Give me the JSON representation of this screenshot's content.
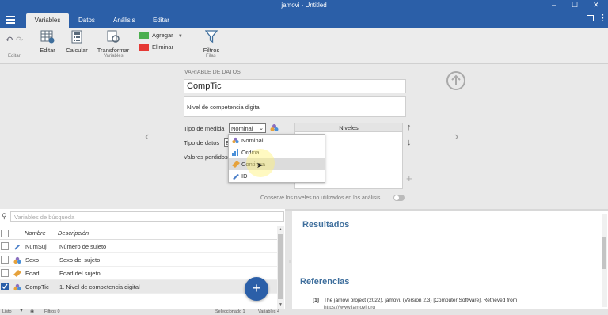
{
  "window": {
    "title": "jamovi - Untitled"
  },
  "tabs": [
    {
      "label": "Variables",
      "active": true
    },
    {
      "label": "Datos",
      "active": false
    },
    {
      "label": "Análisis",
      "active": false
    },
    {
      "label": "Editar",
      "active": false
    }
  ],
  "ribbon": {
    "editar_group": "Editar",
    "variables_group": "Variables",
    "filas_group": "Filas",
    "editar": "Editar",
    "calcular": "Calcular",
    "transformar": "Transformar",
    "agregar": "Agregar",
    "eliminar": "Eliminar",
    "filtros": "Filtros"
  },
  "editor": {
    "header": "VARIABLE DE DATOS",
    "var_name": "CompTic",
    "var_desc": "Nivel de competencia digital",
    "measure_type_label": "Tipo de medida",
    "measure_type_value": "Nominal",
    "data_type_label": "Tipo de datos",
    "data_type_value": "E",
    "missing_label": "Valores perdidos",
    "levels_header": "Niveles",
    "retain_label": "Conserve los niveles no utilizados en los análisis"
  },
  "dropdown": {
    "options": [
      "Nominal",
      "Ordinal",
      "Continua",
      "ID"
    ],
    "highlighted_index": 2
  },
  "grid": {
    "search_placeholder": "Variables de búsqueda",
    "col_name": "Nombre",
    "col_desc": "Descripción",
    "rows": [
      {
        "name": "NumSuj",
        "desc": "Número de sujeto",
        "type": "id",
        "checked": false
      },
      {
        "name": "Sexo",
        "desc": "Sexo del sujeto",
        "type": "nominal",
        "checked": false
      },
      {
        "name": "Edad",
        "desc": "Edad del sujeto",
        "type": "continuous",
        "checked": false
      },
      {
        "name": "CompTic",
        "desc": "1.     Nivel de competencia digital",
        "type": "nominal",
        "checked": true
      }
    ]
  },
  "results": {
    "heading": "Resultados",
    "references_heading": "Referencias",
    "ref_number": "[1]",
    "ref_text": "The jamovi project (2022). jamovi. (Version 2.3) [Computer Software]. Retrieved from",
    "ref_url": "https://www.jamovi.org"
  },
  "status": {
    "mode": "Listo",
    "filters": "Filtros 0",
    "selected": "Seleccionado 1",
    "variables": "Variables 4"
  },
  "colors": {
    "title_bar": "#2b5fa8",
    "heading_blue": "#3e6e9c",
    "accent": "#2b5fa8",
    "highlight_circle": "#fff176"
  }
}
